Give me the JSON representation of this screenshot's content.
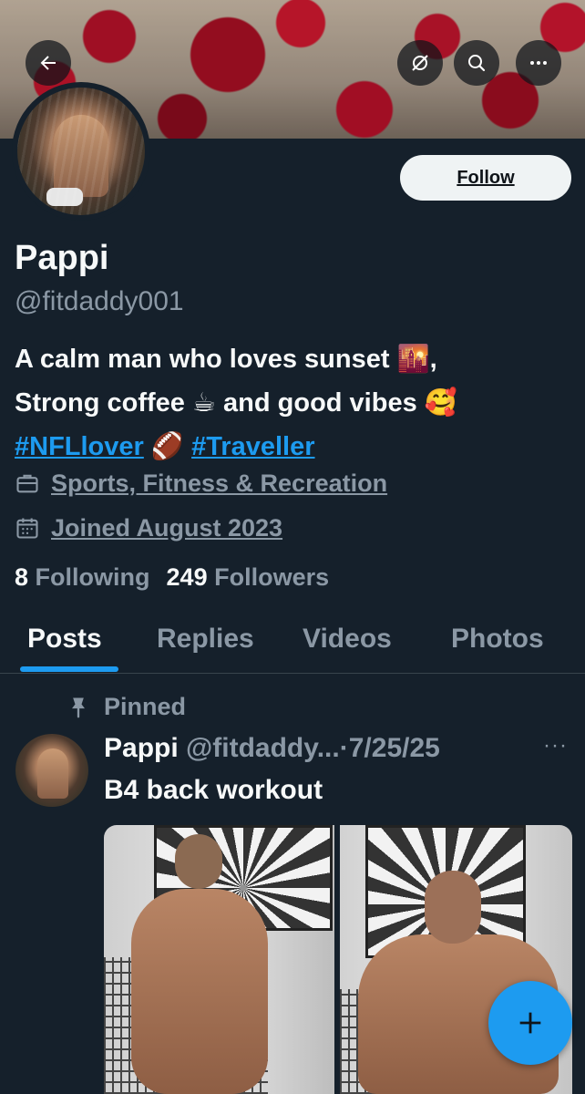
{
  "profile": {
    "name": "Pappi",
    "handle": "@fitdaddy001",
    "bio_line1": "A calm man who loves sunset ",
    "bio_line1_emoji": "🌇",
    "bio_line1_end": ",",
    "bio_line2": "Strong coffee ",
    "bio_line2_emoji1": "☕",
    "bio_line2_mid": " and good vibes ",
    "bio_line2_emoji2": "🥰",
    "hashtag1": "#NFLlover",
    "hashtag1_emoji": "🏈",
    "hashtag2": "#Traveller",
    "category": "Sports, Fitness & Recreation",
    "joined": "Joined August 2023",
    "following_count": "8",
    "following_label": "Following",
    "followers_count": "249",
    "followers_label": "Followers"
  },
  "header": {
    "follow_label": "Follow"
  },
  "tabs": [
    {
      "label": "Posts",
      "active": true
    },
    {
      "label": "Replies",
      "active": false
    },
    {
      "label": "Videos",
      "active": false
    },
    {
      "label": "Photos",
      "active": false
    }
  ],
  "post": {
    "pinned_label": "Pinned",
    "author_name": "Pappi",
    "author_handle": "@fitdaddy...",
    "separator": "·",
    "date": "7/25/25",
    "more": "···",
    "text": "B4 back workout"
  },
  "colors": {
    "background": "#15202b",
    "accent": "#1d9bf0",
    "secondary_text": "#8b98a5",
    "primary_text": "#f7f9f9"
  },
  "icons": [
    "back-arrow-icon",
    "grok-icon",
    "search-icon",
    "more-icon",
    "briefcase-icon",
    "calendar-icon",
    "pin-icon",
    "plus-icon"
  ]
}
